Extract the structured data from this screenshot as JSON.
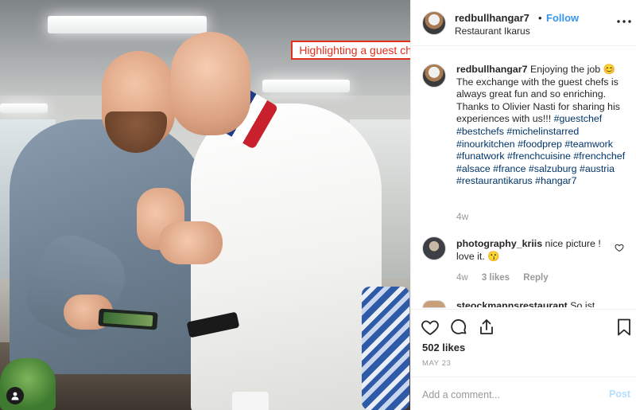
{
  "annotation": {
    "text": "Highlighting a guest chef",
    "color": "#e0301e"
  },
  "header": {
    "username": "redbullhangar7",
    "separator": "•",
    "follow_label": "Follow",
    "location": "Restaurant Ikarus",
    "more_icon": "more-horizontal-icon"
  },
  "caption": {
    "username": "redbullhangar7",
    "text": "Enjoying the job 😊 The exchange with the guest chefs is always great fun and so enriching. Thanks to Olivier Nasti for sharing his experiences with us!!!",
    "hashtags": "#guestchef #bestchefs #michelinstarred #inourkitchen #foodprep #teamwork #funatwork #frenchcuisine #frenchchef #alsace #france #salzuburg #austria #restaurantikarus #hangar7",
    "time_ago": "4w"
  },
  "comments": [
    {
      "username": "photography_kriis",
      "text": "nice picture ! love it. 😗",
      "time_ago": "4w",
      "likes": "3 likes",
      "reply_label": "Reply"
    },
    {
      "username": "steockmannsrestaurant",
      "text": "So ist"
    }
  ],
  "actions": {
    "likes": "502 likes",
    "date": "MAY 23",
    "comment_placeholder": "Add a comment...",
    "post_label": "Post"
  },
  "colors": {
    "link_blue": "#3897f0",
    "hashtag": "#003569",
    "muted": "#999999",
    "post_disabled": "#b2dffc"
  }
}
